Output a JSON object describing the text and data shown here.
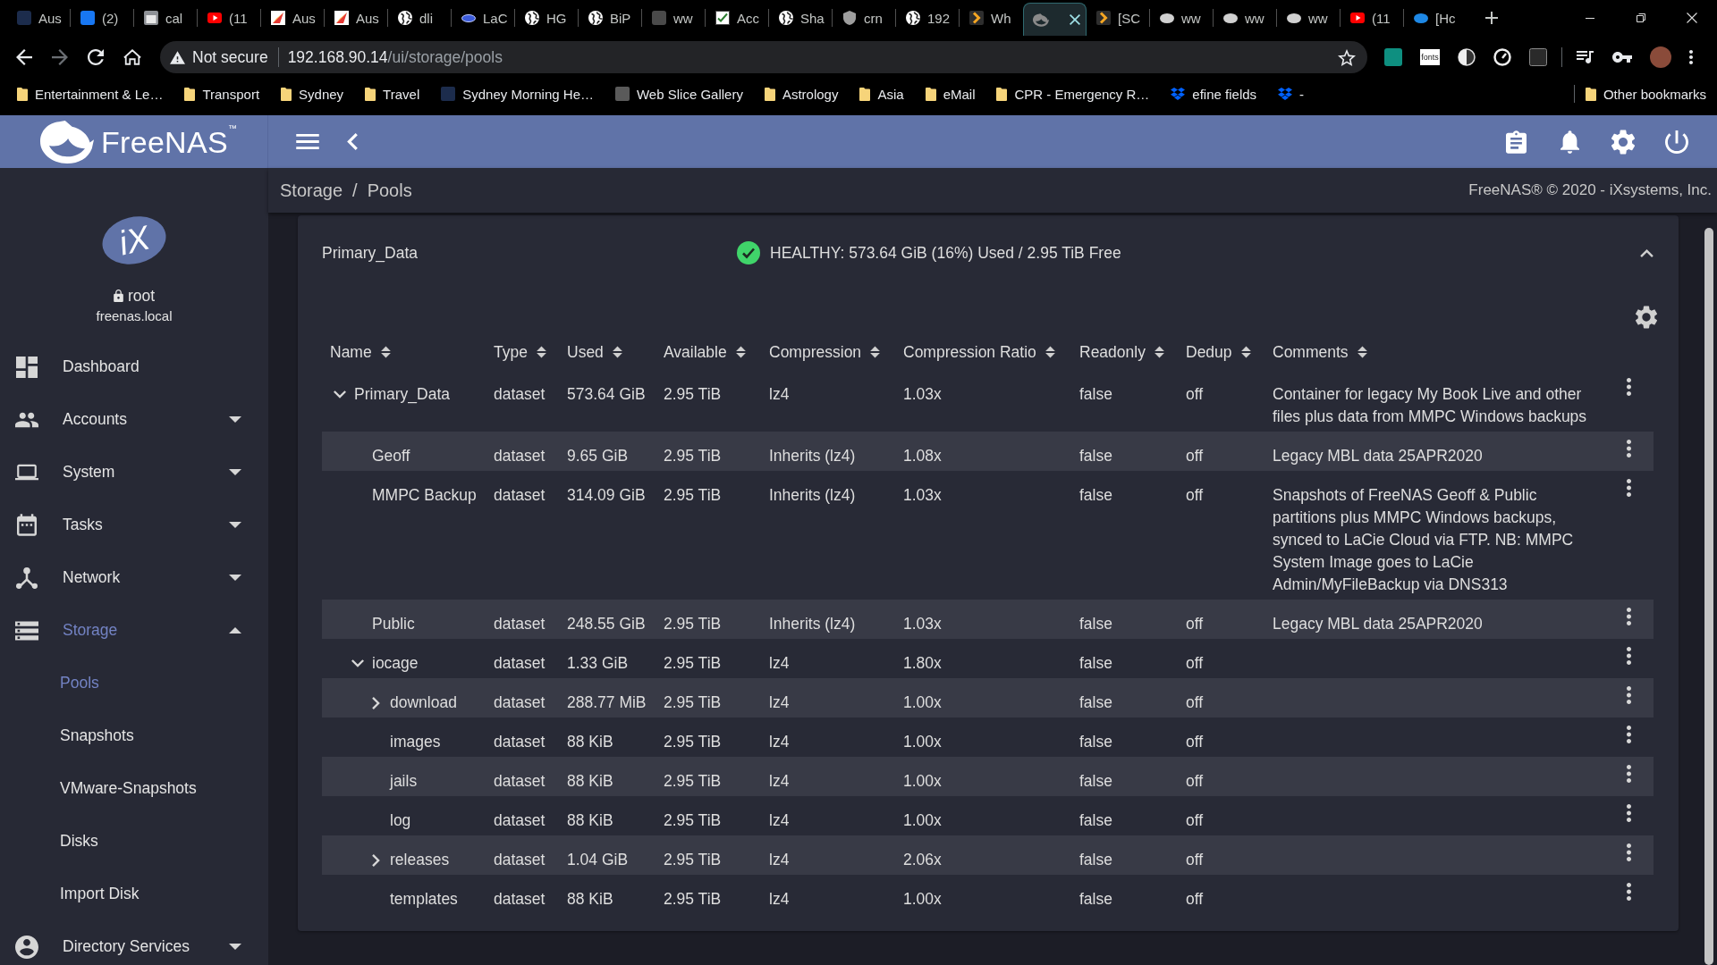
{
  "browser": {
    "tabs": [
      {
        "title": "Aus",
        "selected": false
      },
      {
        "title": "(2)",
        "selected": false
      },
      {
        "title": "cal",
        "selected": false
      },
      {
        "title": "(11",
        "selected": false
      },
      {
        "title": "Aus",
        "selected": false
      },
      {
        "title": "Aus",
        "selected": false
      },
      {
        "title": "dli",
        "selected": false
      },
      {
        "title": "LaC",
        "selected": false
      },
      {
        "title": "HG",
        "selected": false
      },
      {
        "title": "BiP",
        "selected": false
      },
      {
        "title": "ww",
        "selected": false
      },
      {
        "title": "Acc",
        "selected": false
      },
      {
        "title": "Sha",
        "selected": false
      },
      {
        "title": "crn",
        "selected": false
      },
      {
        "title": "192",
        "selected": false
      },
      {
        "title": "Wh",
        "selected": false
      },
      {
        "selected": true
      },
      {
        "title": "[SC",
        "selected": false
      },
      {
        "title": "ww",
        "selected": false
      },
      {
        "title": "ww",
        "selected": false
      },
      {
        "title": "ww",
        "selected": false
      },
      {
        "title": "(11",
        "selected": false
      },
      {
        "title": "[Hc",
        "selected": false
      }
    ],
    "address": {
      "security": "Not secure",
      "host": "192.168.90.14",
      "path": "/ui/storage/pools"
    },
    "extension_label": "fonts",
    "bookmarks": [
      {
        "label": "Entertainment & Le…",
        "kind": "folder"
      },
      {
        "label": "Transport",
        "kind": "folder"
      },
      {
        "label": "Sydney",
        "kind": "folder"
      },
      {
        "label": "Travel",
        "kind": "folder"
      },
      {
        "label": "Sydney Morning He…",
        "kind": "link"
      },
      {
        "label": "Web Slice Gallery",
        "kind": "link"
      },
      {
        "label": "Astrology",
        "kind": "folder"
      },
      {
        "label": "Asia",
        "kind": "folder"
      },
      {
        "label": "eMail",
        "kind": "folder"
      },
      {
        "label": "CPR - Emergency R…",
        "kind": "folder"
      },
      {
        "label": "efine fields",
        "kind": "link"
      },
      {
        "label": "-",
        "kind": "link"
      }
    ],
    "other_bookmarks": "Other bookmarks"
  },
  "app": {
    "brand": "FreeNAS$^{™}$",
    "sidebar": {
      "logo": "iX",
      "user": "root",
      "host": "freenas.local",
      "items": [
        {
          "label": "Dashboard",
          "kind": "link",
          "selected": false
        },
        {
          "label": "Accounts",
          "kind": "group",
          "expanded": false,
          "selected": false
        },
        {
          "label": "System",
          "kind": "group",
          "expanded": false,
          "selected": false
        },
        {
          "label": "Tasks",
          "kind": "group",
          "expanded": false,
          "selected": false
        },
        {
          "label": "Network",
          "kind": "group",
          "expanded": false,
          "selected": false
        },
        {
          "label": "Storage",
          "kind": "group",
          "expanded": true,
          "selected": true,
          "children": [
            {
              "label": "Pools",
              "selected": true
            },
            {
              "label": "Snapshots",
              "selected": false
            },
            {
              "label": "VMware-Snapshots",
              "selected": false
            },
            {
              "label": "Disks",
              "selected": false
            },
            {
              "label": "Import Disk",
              "selected": false
            }
          ]
        },
        {
          "label": "Directory Services",
          "kind": "group",
          "expanded": false,
          "selected": false
        }
      ]
    },
    "breadcrumb": {
      "items": [
        "Storage",
        "Pools"
      ],
      "separator": "/"
    },
    "copyright": "FreeNAS® © 2020 - iXsystems, Inc.",
    "pool": {
      "name": "Primary_Data",
      "healthy": true,
      "summary": "HEALTHY: 573.64 GiB (16%) Used / 2.95 TiB Free",
      "expanded": true,
      "columns": [
        "Name",
        "Type",
        "Used",
        "Available",
        "Compression",
        "Compression Ratio",
        "Readonly",
        "Dedup",
        "Comments"
      ],
      "rows": [
        {
          "name": "Primary_Data",
          "kind": "parent",
          "expanded": true,
          "type": "dataset",
          "used": "573.64 GiB",
          "available": "2.95 TiB",
          "compression": "lz4",
          "ratio": "1.03x",
          "readonly": "false",
          "dedup": "off",
          "comments": "Container for legacy My Book Live and other files plus data from MMPC Windows backups",
          "children": [
            {
              "name": "Geoff",
              "kind": "leaf",
              "type": "dataset",
              "used": "9.65 GiB",
              "available": "2.95 TiB",
              "compression": "Inherits (lz4)",
              "ratio": "1.08x",
              "readonly": "false",
              "dedup": "off",
              "comments": "Legacy MBL data 25APR2020"
            },
            {
              "name": "MMPC Backup",
              "kind": "leaf",
              "type": "dataset",
              "used": "314.09 GiB",
              "available": "2.95 TiB",
              "compression": "Inherits (lz4)",
              "ratio": "1.03x",
              "readonly": "false",
              "dedup": "off",
              "comments": "Snapshots of FreeNAS Geoff & Public partitions plus MMPC Windows backups, synced to LaCie Cloud via FTP. NB: MMPC System Image goes to LaCie Admin/MyFileBackup via DNS313"
            },
            {
              "name": "Public",
              "kind": "leaf",
              "type": "dataset",
              "used": "248.55 GiB",
              "available": "2.95 TiB",
              "compression": "Inherits (lz4)",
              "ratio": "1.03x",
              "readonly": "false",
              "dedup": "off",
              "comments": "Legacy MBL data 25APR2020"
            },
            {
              "name": "iocage",
              "kind": "parent",
              "expanded": true,
              "type": "dataset",
              "used": "1.33 GiB",
              "available": "2.95 TiB",
              "compression": "lz4",
              "ratio": "1.80x",
              "readonly": "false",
              "dedup": "off",
              "children": [
                {
                  "name": "download",
                  "kind": "parent",
                  "expanded": false,
                  "type": "dataset",
                  "used": "288.77 MiB",
                  "available": "2.95 TiB",
                  "compression": "lz4",
                  "ratio": "1.00x",
                  "readonly": "false",
                  "dedup": "off"
                },
                {
                  "name": "images",
                  "kind": "leaf",
                  "type": "dataset",
                  "used": "88 KiB",
                  "available": "2.95 TiB",
                  "compression": "lz4",
                  "ratio": "1.00x",
                  "readonly": "false",
                  "dedup": "off"
                },
                {
                  "name": "jails",
                  "kind": "leaf",
                  "type": "dataset",
                  "used": "88 KiB",
                  "available": "2.95 TiB",
                  "compression": "lz4",
                  "ratio": "1.00x",
                  "readonly": "false",
                  "dedup": "off"
                },
                {
                  "name": "log",
                  "kind": "leaf",
                  "type": "dataset",
                  "used": "88 KiB",
                  "available": "2.95 TiB",
                  "compression": "lz4",
                  "ratio": "1.00x",
                  "readonly": "false",
                  "dedup": "off"
                },
                {
                  "name": "releases",
                  "kind": "parent",
                  "expanded": false,
                  "type": "dataset",
                  "used": "1.04 GiB",
                  "available": "2.95 TiB",
                  "compression": "lz4",
                  "ratio": "2.06x",
                  "readonly": "false",
                  "dedup": "off"
                },
                {
                  "name": "templates",
                  "kind": "leaf",
                  "type": "dataset",
                  "used": "88 KiB",
                  "available": "2.95 TiB",
                  "compression": "lz4",
                  "ratio": "1.00x",
                  "readonly": "false",
                  "dedup": "off"
                }
              ]
            }
          ]
        }
      ]
    }
  }
}
